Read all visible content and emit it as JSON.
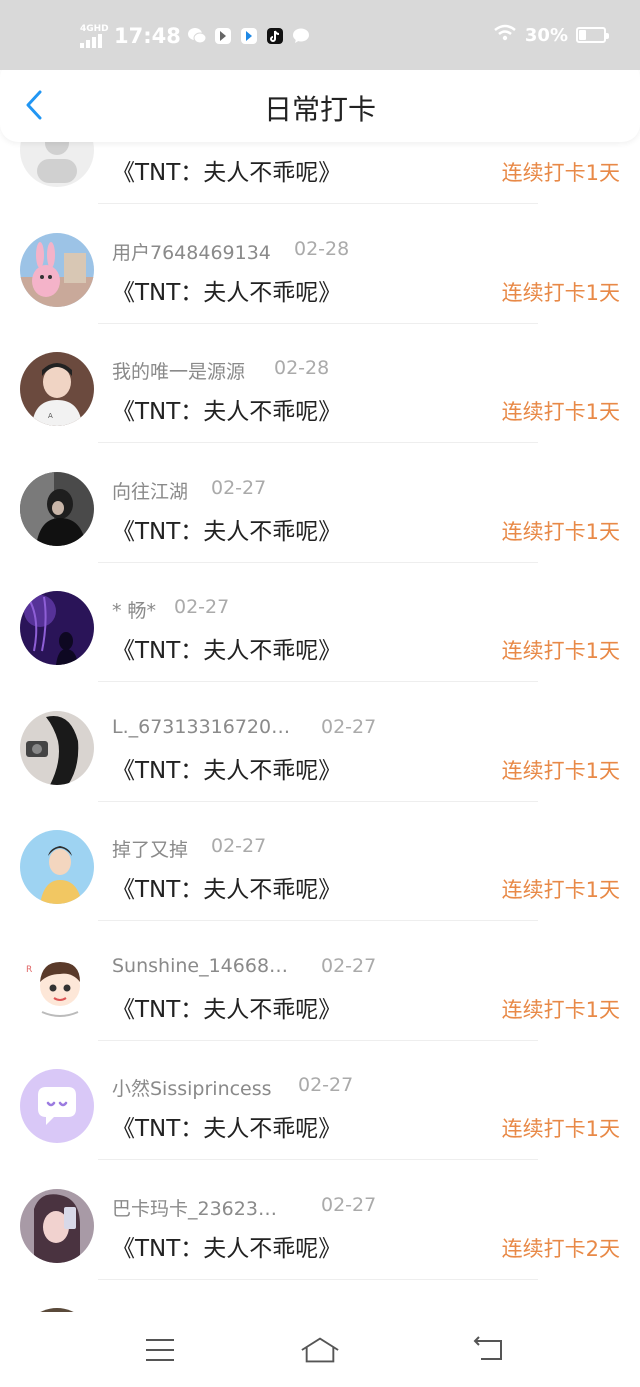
{
  "status_bar": {
    "network": "4GHD",
    "time": "17:48",
    "battery_text": "30%",
    "battery_level": 0.3,
    "notification_icons": [
      "wechat-icon",
      "app-icon",
      "app-icon-blue",
      "tiktok-icon",
      "message-icon"
    ]
  },
  "header": {
    "title": "日常打卡",
    "back_icon": "chevron-left-icon"
  },
  "colors": {
    "accent_blue": "#2196f3",
    "streak_orange": "#e88947"
  },
  "list": {
    "items": [
      {
        "name": "",
        "date": "",
        "book": "《TNT：夫人不乖呢》",
        "streak": "连续打卡1天",
        "avatar": "placeholder-avatar"
      },
      {
        "name": "用户7648469134",
        "date": "02-28",
        "book": "《TNT：夫人不乖呢》",
        "streak": "连续打卡1天",
        "avatar": "pink-bunny-avatar"
      },
      {
        "name": "我的唯一是源源",
        "date": "02-28",
        "book": "《TNT：夫人不乖呢》",
        "streak": "连续打卡1天",
        "avatar": "boy-photo-avatar"
      },
      {
        "name": "向往江湖",
        "date": "02-27",
        "book": "《TNT：夫人不乖呢》",
        "streak": "连续打卡1天",
        "avatar": "dark-photo-avatar"
      },
      {
        "name": "* 畅*",
        "date": "02-27",
        "book": "《TNT：夫人不乖呢》",
        "streak": "连续打卡1天",
        "avatar": "purple-night-avatar"
      },
      {
        "name": "L._67313316720…",
        "date": "02-27",
        "book": "《TNT：夫人不乖呢》",
        "streak": "连续打卡1天",
        "avatar": "girl-hair-avatar"
      },
      {
        "name": "掉了又掉",
        "date": "02-27",
        "book": "《TNT：夫人不乖呢》",
        "streak": "连续打卡1天",
        "avatar": "sky-boy-avatar"
      },
      {
        "name": "Sunshine_14668…",
        "date": "02-27",
        "book": "《TNT：夫人不乖呢》",
        "streak": "连续打卡1天",
        "avatar": "cartoon-boy-avatar"
      },
      {
        "name": "小然Sissiprincess",
        "date": "02-27",
        "book": "《TNT：夫人不乖呢》",
        "streak": "连续打卡1天",
        "avatar": "chat-bubble-avatar"
      },
      {
        "name": "巴卡玛卡_23623…",
        "date": "02-27",
        "book": "《TNT：夫人不乖呢》",
        "streak": "连续打卡2天",
        "avatar": "girl-phone-avatar"
      }
    ]
  },
  "nav": {
    "menu_icon": "menu-icon",
    "home_icon": "home-icon",
    "back_icon": "back-icon"
  }
}
